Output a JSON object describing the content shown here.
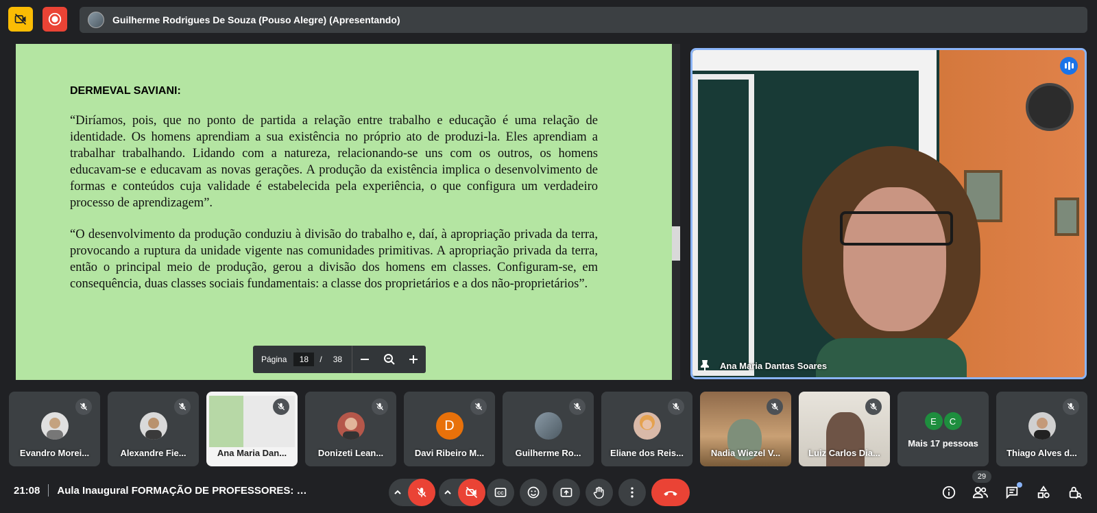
{
  "header": {
    "presenter_label": "Guilherme Rodrigues De Souza (Pouso Alegre) (Apresentando)"
  },
  "slide": {
    "heading": "DERMEVAL SAVIANI:",
    "paragraph1": "“Diríamos, pois, que no ponto de partida a relação entre trabalho e educação é uma relação de identidade. Os homens aprendiam a sua existência no próprio ato de produzi-la. Eles aprendiam a trabalhar trabalhando. Lidando com a natureza, relacionando-se uns com os outros, os homens educavam-se e educavam as novas gerações. A produção da existência implica o desenvolvimento de formas e conteúdos cuja validade é estabelecida pela experiência, o que configura um verdadeiro processo de aprendizagem”.",
    "paragraph2": "“O desenvolvimento da produção conduziu à divisão do trabalho e, daí, à apropriação privada da terra, provocando a ruptura da unidade vigente nas comunidades primitivas. A apropriação privada da terra, então o principal meio de produção, gerou a divisão dos homens em classes. Configuram-se, em consequência, duas classes sociais fundamentais: a classe dos proprietários e a dos não-proprietários”."
  },
  "pdf_toolbar": {
    "page_label": "Página",
    "current_page": "18",
    "separator": "/",
    "total_pages": "38"
  },
  "main_video": {
    "name": "Ana Maria Dantas Soares"
  },
  "participants": [
    {
      "name": "Evandro Morei...",
      "avatar_color": "#5f6368"
    },
    {
      "name": "Alexandre Fie...",
      "avatar_color": "#5f6368"
    },
    {
      "name": "Ana Maria Dan...",
      "avatar_color": "#ffffff"
    },
    {
      "name": "Donizeti Lean...",
      "avatar_color": "#8d5a4a"
    },
    {
      "name": "Davi Ribeiro M...",
      "avatar_letter": "D",
      "avatar_color": "#e8710a"
    },
    {
      "name": "Guilherme Ro...",
      "avatar_color": "#8a9aa6"
    },
    {
      "name": "Eliane dos Reis...",
      "avatar_color": "#b07b6a"
    },
    {
      "name": "Nadia Wiezel V...",
      "avatar_color": "#c9a074"
    },
    {
      "name": "Luiz Carlos Dia...",
      "avatar_color": "#cfcac0"
    },
    {
      "name": "Mais 17 pessoas",
      "avatar_letters": [
        "E",
        "C"
      ],
      "avatar_color": "#1e8e3e"
    },
    {
      "name": "Thiago Alves d...",
      "avatar_color": "#5f6368"
    }
  ],
  "bottom_bar": {
    "time": "21:08",
    "meeting_title": "Aula Inaugural FORMAÇÃO DE PROFESSORES: MET...",
    "people_count": "29"
  },
  "colors": {
    "background": "#202124",
    "surface": "#3c4043",
    "red": "#ea4335",
    "yellow": "#fbbc04",
    "accent_blue": "#8ab4f8",
    "slide_bg": "#b4e5a2"
  }
}
